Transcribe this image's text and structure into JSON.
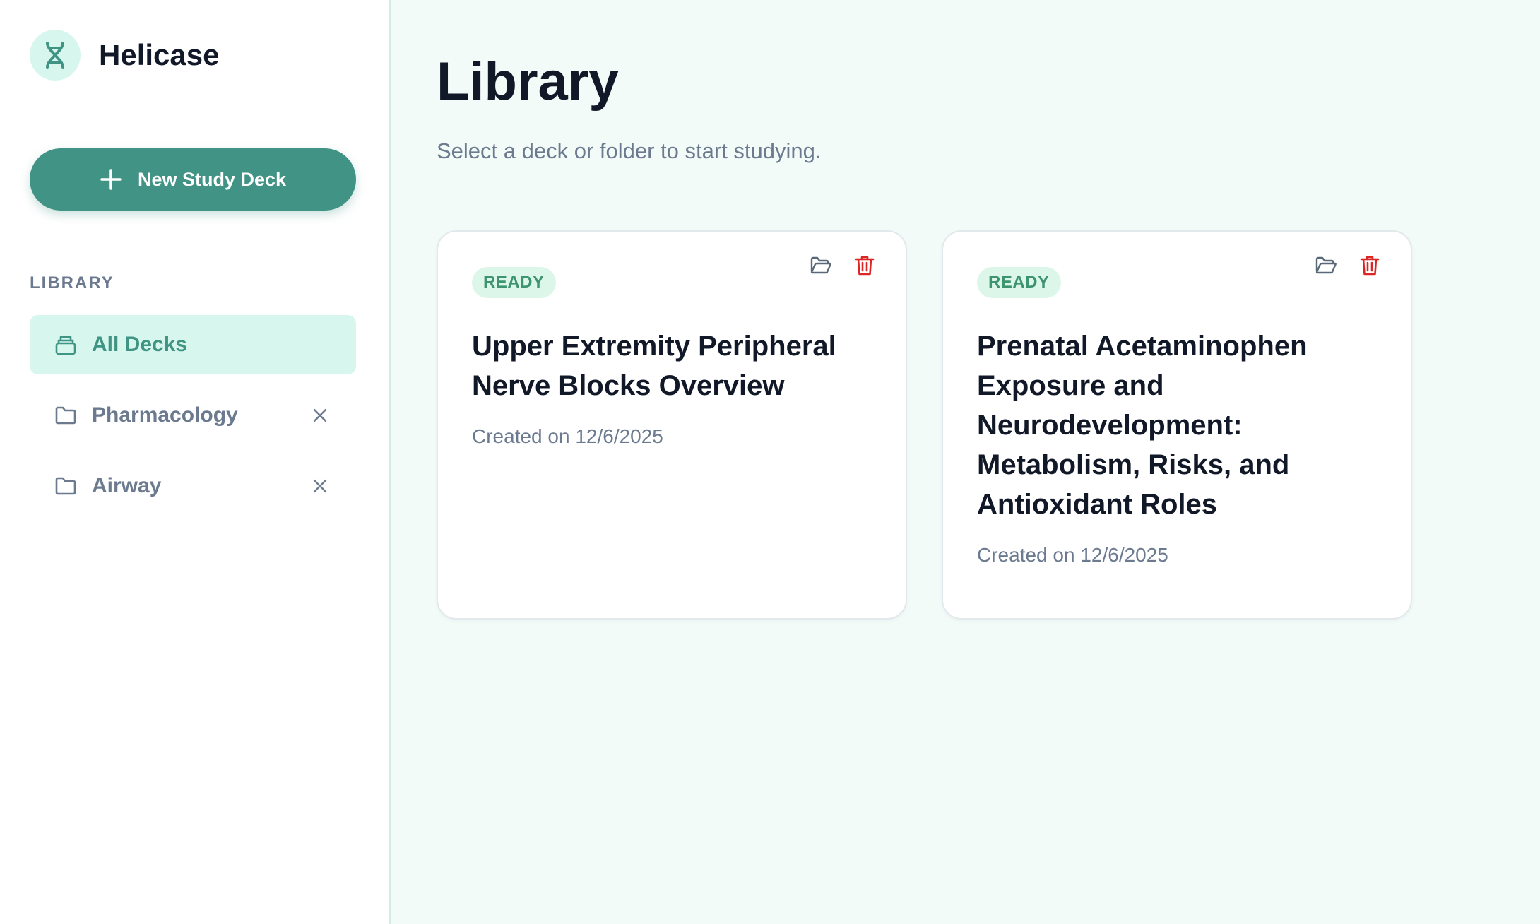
{
  "brand": {
    "name": "Helicase",
    "logo_icon": "dna-icon"
  },
  "sidebar": {
    "new_deck_label": "New Study Deck",
    "section_label": "LIBRARY",
    "items": [
      {
        "label": "All Decks",
        "icon": "archive-icon",
        "active": true
      },
      {
        "label": "Pharmacology",
        "icon": "folder-icon",
        "removable": true
      },
      {
        "label": "Airway",
        "icon": "folder-icon",
        "removable": true
      }
    ]
  },
  "main": {
    "title": "Library",
    "subtitle": "Select a deck or folder to start studying.",
    "decks": [
      {
        "status": "READY",
        "title": "Upper Extremity Peripheral Nerve Blocks Overview",
        "created": "Created on 12/6/2025"
      },
      {
        "status": "READY",
        "title": "Prenatal Acetaminophen Exposure and Neurodevelopment: Metabolism, Risks, and Antioxidant Roles",
        "created": "Created on 12/6/2025"
      }
    ]
  },
  "colors": {
    "accent": "#419385",
    "accent_light": "#d6f6ee",
    "status_ready_bg": "#dcf7ea",
    "status_ready_text": "#3f9470",
    "danger": "#dc2626",
    "muted": "#6b7a8f"
  }
}
